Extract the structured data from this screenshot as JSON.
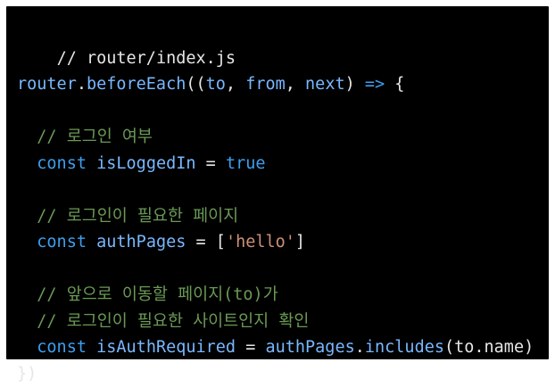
{
  "code": {
    "file_comment": "// router/index.js",
    "line2": {
      "obj": "router",
      "dot": ".",
      "method": "beforeEach",
      "open": "((",
      "p1": "to",
      "comma1": ", ",
      "p2": "from",
      "comma2": ", ",
      "p3": "next",
      "close": ") ",
      "arrow": "=>",
      "brace": " {"
    },
    "comment_login": "  // 로그인 여부",
    "line_logged": {
      "indent": "  ",
      "kw": "const",
      "sp": " ",
      "name": "isLoggedIn",
      "eq": " = ",
      "val": "true"
    },
    "comment_auth": "  // 로그인이 필요한 페이지",
    "line_auth": {
      "indent": "  ",
      "kw": "const",
      "sp": " ",
      "name": "authPages",
      "eq": " = [",
      "str": "'hello'",
      "end": "]"
    },
    "comment_next": "  // 앞으로 이동할 페이지(to)가",
    "comment_site": "  // 로그인이 필요한 사이트인지 확인",
    "line_req": {
      "indent": "  ",
      "kw": "const",
      "sp": " ",
      "name": "isAuthRequired",
      "eq": " = ",
      "obj": "authPages",
      "dot": ".",
      "method": "includes",
      "args": "(to.name)"
    },
    "closing": "})"
  },
  "colors": {
    "background": "#000000",
    "comment": "#6a9955",
    "variable": "#79b8ff",
    "string": "#ce9178",
    "keyword": "#569cd6"
  }
}
